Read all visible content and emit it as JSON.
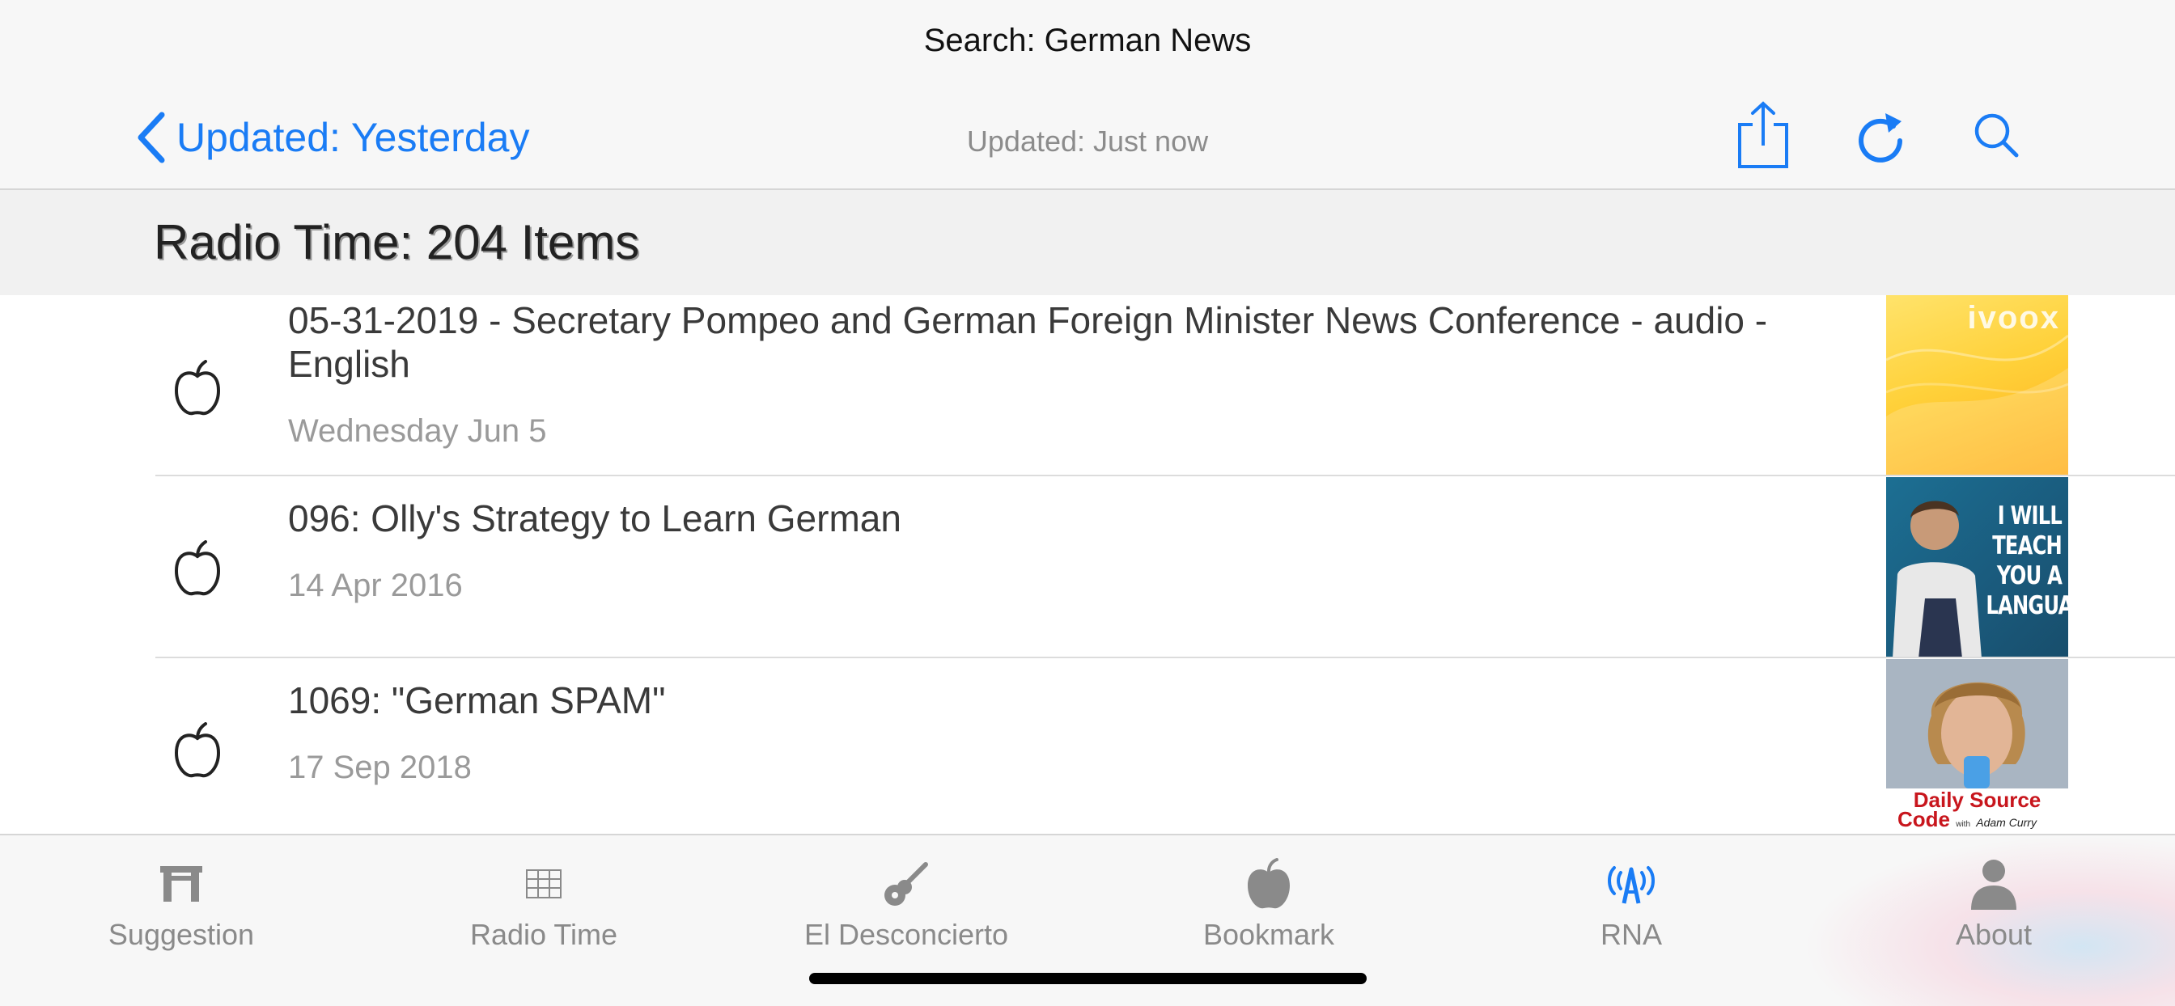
{
  "nav": {
    "title": "Search: German News",
    "back_label": "Updated: Yesterday",
    "subtitle": "Updated: Just now",
    "icons": [
      "share-icon",
      "refresh-icon",
      "search-icon"
    ],
    "accent_color": "#1a7cf5"
  },
  "section": {
    "title": "Radio Time: 204 Items"
  },
  "items": [
    {
      "title": "05-31-2019 - Secretary Pompeo and German Foreign Minister News Conference - audio - English",
      "date": "Wednesday Jun 5",
      "thumb": {
        "text": "ivoox"
      }
    },
    {
      "title": "096: Olly's Strategy to Learn German",
      "date": "14 Apr 2016",
      "thumb": {
        "lines": [
          "I WILL",
          "TEACH",
          "YOU A",
          "LANGUAGE"
        ]
      }
    },
    {
      "title": "1069: \"German SPAM\"",
      "date": "17 Sep 2018",
      "thumb": {
        "line1": "Daily Source",
        "line2": "Code",
        "small1": "with",
        "small2": "Adam Curry"
      }
    }
  ],
  "tabs": [
    {
      "label": "Suggestion",
      "icon": "gate-icon"
    },
    {
      "label": "Radio Time",
      "icon": "grid-icon"
    },
    {
      "label": "El Desconcierto",
      "icon": "guitar-icon"
    },
    {
      "label": "Bookmark",
      "icon": "apple-icon"
    },
    {
      "label": "RNA",
      "icon": "antenna-icon",
      "active": true
    },
    {
      "label": "About",
      "icon": "person-icon"
    }
  ]
}
